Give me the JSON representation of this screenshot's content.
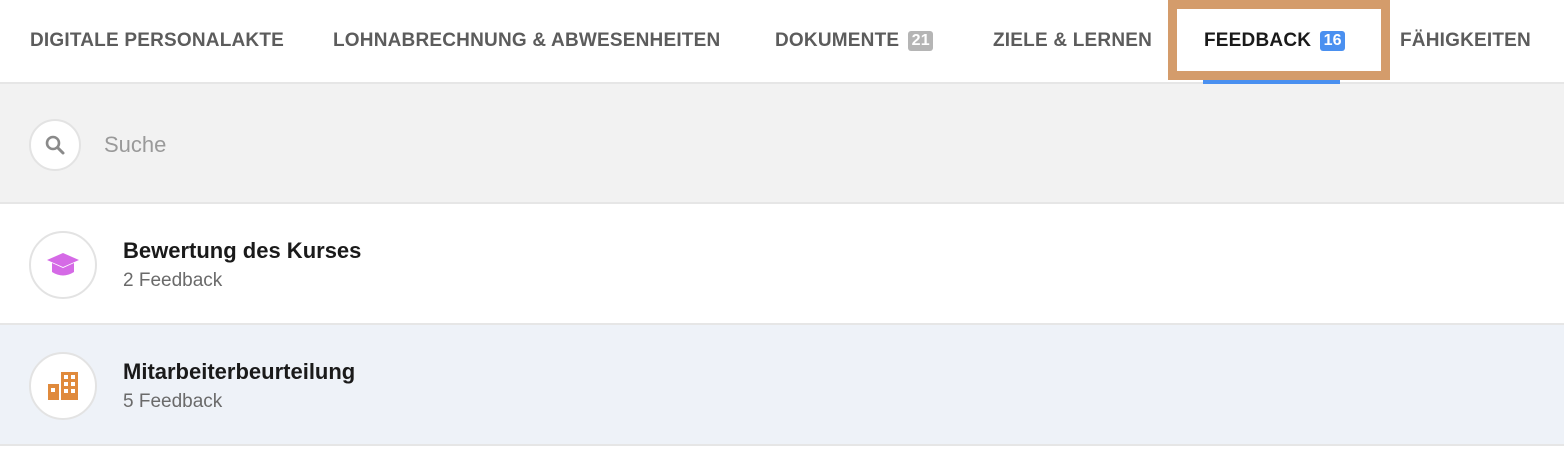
{
  "tabs": [
    {
      "label": "DIGITALE PERSONALAKTE",
      "badge": null,
      "active": false
    },
    {
      "label": "LOHNABRECHNUNG & ABWESENHEITEN",
      "badge": null,
      "active": false
    },
    {
      "label": "DOKUMENTE",
      "badge": "21",
      "active": false
    },
    {
      "label": "ZIELE & LERNEN",
      "badge": null,
      "active": false
    },
    {
      "label": "FEEDBACK",
      "badge": "16",
      "active": true
    },
    {
      "label": "FÄHIGKEITEN",
      "badge": null,
      "active": false
    }
  ],
  "search": {
    "placeholder": "Suche",
    "value": ""
  },
  "items": [
    {
      "title": "Bewertung des Kurses",
      "subtitle": "2 Feedback",
      "icon": "graduation-cap-icon",
      "icon_color": "#d56ae6"
    },
    {
      "title": "Mitarbeiterbeurteilung",
      "subtitle": "5 Feedback",
      "icon": "building-icon",
      "icon_color": "#e08a3c"
    }
  ],
  "colors": {
    "accent": "#4a90f0",
    "highlight_border": "#d49c6b",
    "badge_grey": "#b5b5b5"
  }
}
